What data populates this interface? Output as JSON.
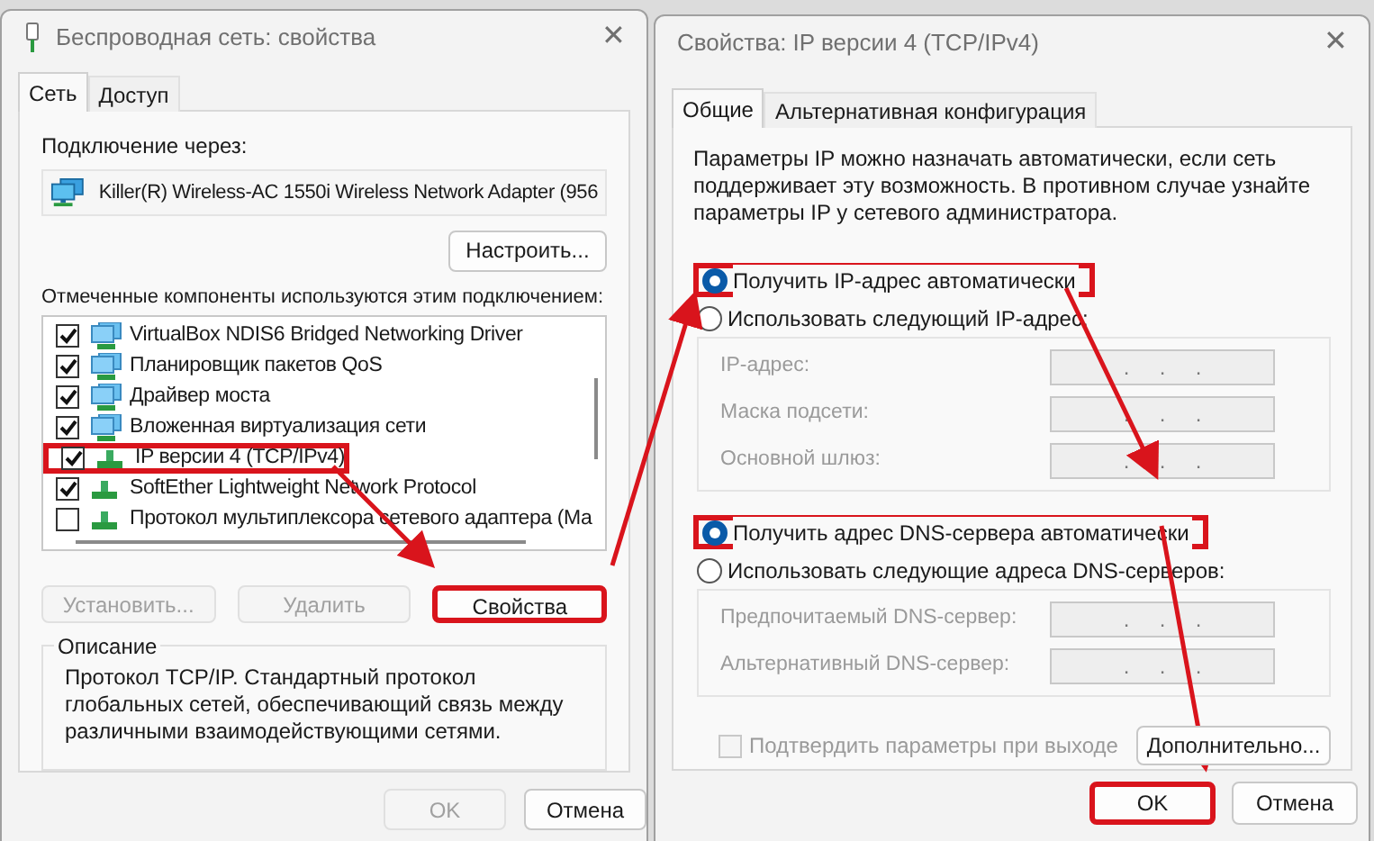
{
  "left_window": {
    "title": "Беспроводная сеть: свойства",
    "close": "✕",
    "tabs": [
      {
        "label": "Сеть",
        "selected": true
      },
      {
        "label": "Доступ",
        "selected": false
      }
    ],
    "connect_label": "Подключение через:",
    "adapter": "Killer(R) Wireless-AC 1550i Wireless Network Adapter (956",
    "configure_button": "Настроить...",
    "components_label": "Отмеченные компоненты используются этим подключением:",
    "components": [
      {
        "kind": "service",
        "label": "VirtualBox NDIS6 Bridged Networking Driver",
        "checked": true,
        "highlighted": false
      },
      {
        "kind": "service",
        "label": "Планировщик пакетов QoS",
        "checked": true,
        "highlighted": false
      },
      {
        "kind": "service",
        "label": "Драйвер моста",
        "checked": true,
        "highlighted": false
      },
      {
        "kind": "service",
        "label": "Вложенная виртуализация сети",
        "checked": true,
        "highlighted": false
      },
      {
        "kind": "protocol",
        "label": "IP версии 4 (TCP/IPv4)",
        "checked": true,
        "highlighted": true
      },
      {
        "kind": "protocol",
        "label": "SoftEther Lightweight Network Protocol",
        "checked": true,
        "highlighted": false
      },
      {
        "kind": "protocol",
        "label": "Протокол мультиплексора сетевого адаптера (Ма",
        "checked": false,
        "highlighted": false
      }
    ],
    "action_buttons": [
      {
        "label": "Установить...",
        "disabled": true,
        "highlighted": false
      },
      {
        "label": "Удалить",
        "disabled": true,
        "highlighted": false
      },
      {
        "label": "Свойства",
        "disabled": false,
        "highlighted": true
      }
    ],
    "description": {
      "title": "Описание",
      "text": "Протокол TCP/IP. Стандартный протокол глобальных сетей, обеспечивающий связь между различными взаимодействующими сетями."
    },
    "dialog_buttons": [
      {
        "label": "OK",
        "disabled": true,
        "highlighted": false
      },
      {
        "label": "Отмена",
        "disabled": false,
        "highlighted": false
      }
    ]
  },
  "right_window": {
    "title": "Свойства: IP версии 4 (TCP/IPv4)",
    "close": "✕",
    "tabs": [
      {
        "label": "Общие",
        "selected": true
      },
      {
        "label": "Альтернативная конфигурация",
        "selected": false
      }
    ],
    "intro": "Параметры IP можно назначать автоматически, если сеть поддерживает эту возможность. В противном случае узнайте параметры IP у сетевого администратора.",
    "ip_radios": [
      {
        "label": "Получить IP-адрес автоматически",
        "selected": true,
        "highlighted": true
      },
      {
        "label": "Использовать следующий IP-адрес:",
        "selected": false,
        "highlighted": false
      }
    ],
    "ip_fields": [
      {
        "label": "IP-адрес:",
        "value": ".     .     .",
        "disabled": true
      },
      {
        "label": "Маска подсети:",
        "value": ".     .     .",
        "disabled": true
      },
      {
        "label": "Основной шлюз:",
        "value": ".     .     .",
        "disabled": true
      }
    ],
    "dns_radios": [
      {
        "label": "Получить адрес DNS-сервера автоматически",
        "selected": true,
        "highlighted": true
      },
      {
        "label": "Использовать следующие адреса DNS-серверов:",
        "selected": false,
        "highlighted": false
      }
    ],
    "dns_fields": [
      {
        "label": "Предпочитаемый DNS-сервер:",
        "value": ".     .     .",
        "disabled": true
      },
      {
        "label": "Альтернативный DNS-сервер:",
        "value": ".     .     .",
        "disabled": true
      }
    ],
    "validate_checkbox": {
      "label": "Подтвердить параметры при выходе",
      "checked": false,
      "disabled": true
    },
    "advanced_button": "Дополнительно...",
    "dialog_buttons": [
      {
        "label": "OK",
        "disabled": false,
        "highlighted": true
      },
      {
        "label": "Отмена",
        "disabled": false,
        "highlighted": false
      }
    ]
  }
}
